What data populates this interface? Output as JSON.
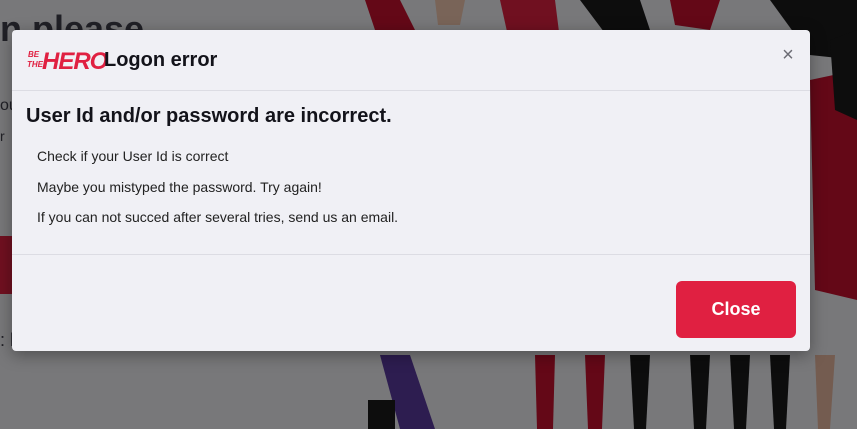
{
  "background": {
    "title_fragment": "n please",
    "text_fragment_1": "ou",
    "text_fragment_2": "r",
    "text_fragment_3": ": h"
  },
  "modal": {
    "title": "Logon error",
    "close_icon": "×",
    "error_heading": "User Id and/or password are incorrect.",
    "messages": [
      "Check if your User Id is correct",
      "Maybe you mistyped the password. Try again!",
      "If you can not succed after several tries, send us an email."
    ],
    "close_button_label": "Close"
  },
  "brand": {
    "logo_small_top": "BE",
    "logo_small_bottom": "THE",
    "logo_big": "HERO"
  },
  "colors": {
    "accent": "#e02041",
    "background": "#f0f0f5",
    "text": "#13131a"
  }
}
